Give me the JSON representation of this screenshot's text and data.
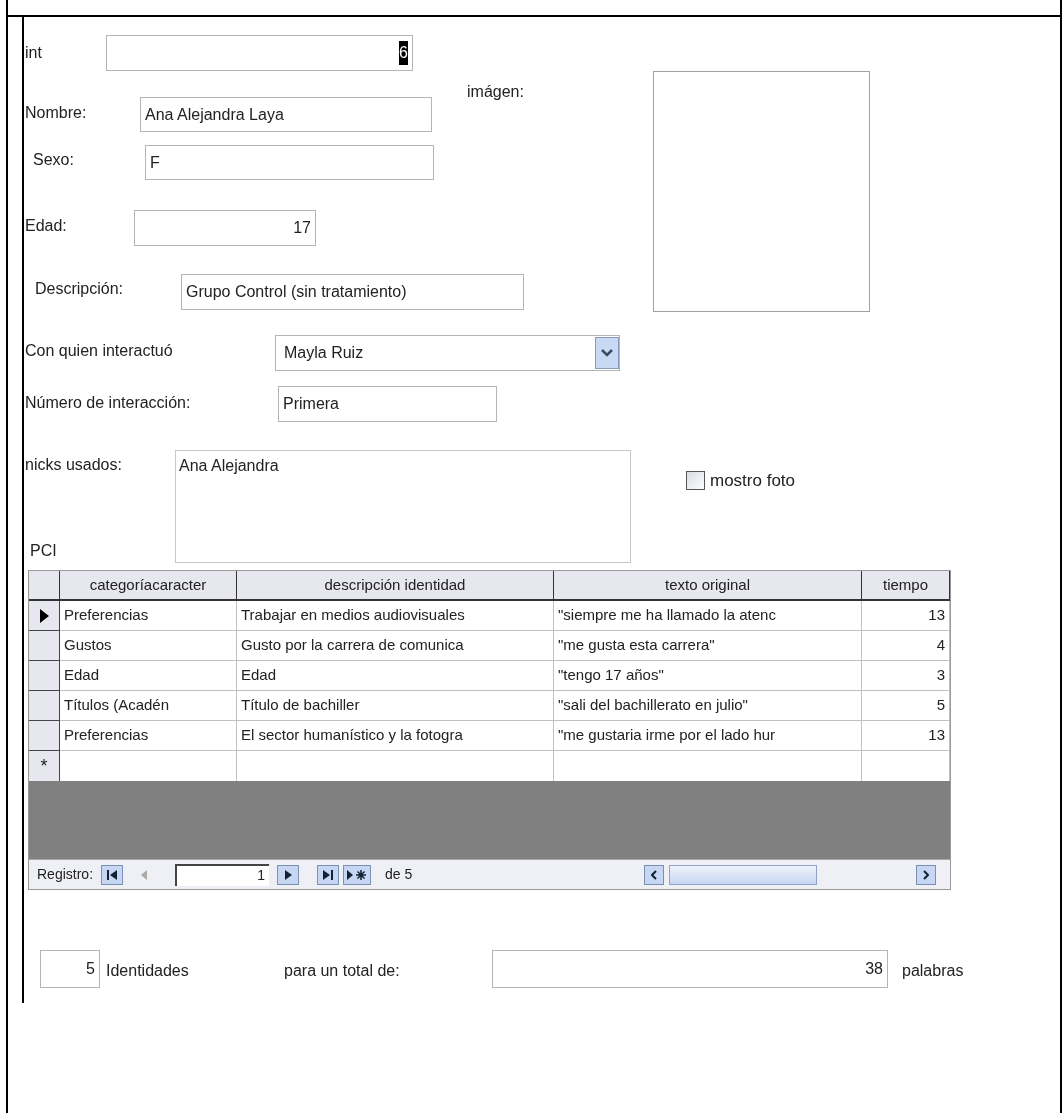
{
  "form": {
    "fields": [
      {
        "kind": "number",
        "label": "int",
        "value": "6",
        "selected": true
      },
      {
        "kind": "text",
        "label": "Nombre:",
        "value": "Ana Alejandra Laya",
        "selected": false
      },
      {
        "kind": "text",
        "label": "Sexo:",
        "value": "F",
        "selected": false
      },
      {
        "kind": "number",
        "label": "Edad:",
        "value": "17",
        "selected": false
      },
      {
        "kind": "text",
        "label": "Descripción:",
        "value": "Grupo Control (sin tratamiento)",
        "selected": false
      },
      {
        "kind": "combo",
        "label": "Con quien interactuó",
        "value": "Mayla Ruiz",
        "selected": false
      },
      {
        "kind": "text",
        "label": "Número de interacción:",
        "value": "Primera",
        "selected": false
      },
      {
        "kind": "memo",
        "label": "nicks usados:",
        "value": "Ana Alejandra",
        "selected": false
      }
    ],
    "image_label": "imágen:",
    "checkbox": {
      "label": "mostro foto",
      "checked": false
    },
    "section_label": "PCI",
    "datasheet": {
      "columns": [
        "categoríacaracter",
        "descripción identidad",
        "texto original",
        "tiempo"
      ],
      "rows": [
        {
          "selected": true,
          "cells": [
            "Preferencias",
            "Trabajar en medios audiovisuales",
            "\"siempre me ha llamado la atenc",
            "13"
          ]
        },
        {
          "selected": false,
          "cells": [
            "Gustos",
            "Gusto por la carrera de comunica",
            "\"me gusta esta carrera\"",
            "4"
          ]
        },
        {
          "selected": false,
          "cells": [
            "Edad",
            "Edad",
            "\"tengo 17 años\"",
            "3"
          ]
        },
        {
          "selected": false,
          "cells": [
            "Títulos (Acadén",
            "Título de bachiller",
            "\"sali del bachillerato en julio\"",
            "5"
          ]
        },
        {
          "selected": false,
          "cells": [
            "Preferencias",
            "El sector humanístico y la fotogra",
            "\"me gustaria irme por el lado hur",
            "13"
          ]
        }
      ],
      "new_row_marker": "*",
      "navigation": {
        "label": "Registro:",
        "record": "1",
        "of": "de 5"
      }
    },
    "summary": {
      "count": "5",
      "count_label": "Identidades",
      "total_label": "para un total de:",
      "total": "38",
      "total_unit": "palabras"
    }
  }
}
